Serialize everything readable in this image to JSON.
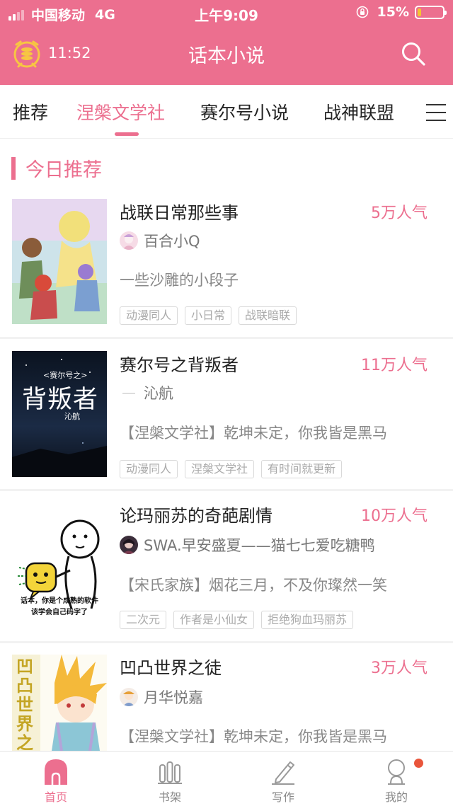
{
  "status_bar": {
    "carrier": "中国移动",
    "network": "4G",
    "time": "上午9:09",
    "battery_percent": "15%",
    "battery_level": 0.15,
    "icons": [
      "signal-icon",
      "orientation-lock-icon",
      "battery-icon"
    ]
  },
  "header": {
    "alarm_time": "11:52",
    "title": "话本小说",
    "icons": [
      "alarm-clock-icon",
      "search-icon"
    ]
  },
  "tabs": [
    {
      "label": "推荐"
    },
    {
      "label": "涅槃文学社"
    },
    {
      "label": "赛尔号小说"
    },
    {
      "label": "战神联盟"
    }
  ],
  "active_tab": "涅槃文学社",
  "section": {
    "title": "今日推荐"
  },
  "books": [
    {
      "title": "战联日常那些事",
      "popularity": "5万人气",
      "author": "百合小Q",
      "description": "一些沙雕的小段子",
      "tags": [
        "动漫同人",
        "小日常",
        "战联暗联"
      ]
    },
    {
      "title": "赛尔号之背叛者",
      "popularity": "11万人气",
      "author": "沁航",
      "description": "【涅槃文学社】乾坤未定，你我皆是黑马",
      "tags": [
        "动漫同人",
        "涅槃文学社",
        "有时间就更新"
      ],
      "cover_text": {
        "subtitle": "<赛尔号之>",
        "title": "背叛者",
        "signature": "沁航"
      }
    },
    {
      "title": "论玛丽苏的奇葩剧情",
      "popularity": "10万人气",
      "author": "SWA.早安盛夏——猫七七爱吃糖鸭",
      "description": "【宋氏家族】烟花三月，不及你璨然一笑",
      "tags": [
        "二次元",
        "作者是小仙女",
        "拒绝狗血玛丽苏"
      ],
      "cover_text": {
        "line1": "话本，你是个成熟的软件",
        "line2": "该学会自己码字了"
      }
    },
    {
      "title": "凹凸世界之徒",
      "popularity": "3万人气",
      "author": "月华悦嘉",
      "description": "【涅槃文学社】乾坤未定，你我皆是黑马",
      "tags": [],
      "cover_text": {
        "vertical": "凹凸世界之"
      }
    }
  ],
  "bottom_nav": [
    {
      "label": "首页",
      "icon": "home-icon",
      "active": true
    },
    {
      "label": "书架",
      "icon": "bookshelf-icon",
      "active": false
    },
    {
      "label": "写作",
      "icon": "pencil-icon",
      "active": false
    },
    {
      "label": "我的",
      "icon": "profile-icon",
      "active": false,
      "badge": true
    }
  ],
  "colors": {
    "brand": "#ec6f8f",
    "badge": "#e9553b",
    "battery": "#f4c430"
  }
}
